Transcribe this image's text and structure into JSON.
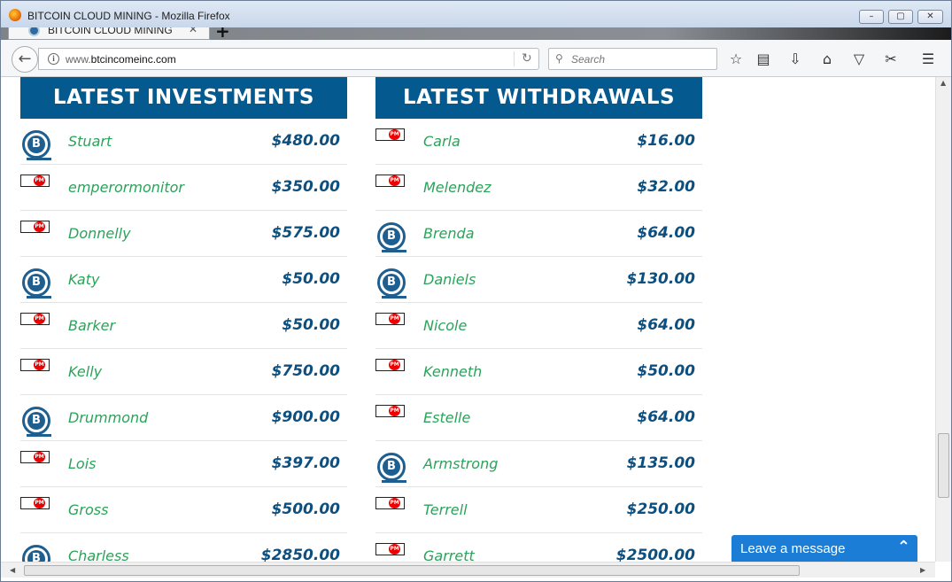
{
  "window": {
    "title": "BITCOIN CLOUD MINING - Mozilla Firefox"
  },
  "tab": {
    "title": "BITCOIN CLOUD MINING"
  },
  "navbar": {
    "url_prefix": "www.",
    "url_domain": "btcincomeinc.com",
    "search_placeholder": "Search"
  },
  "investments": {
    "title": "LATEST INVESTMENTS",
    "rows": [
      {
        "method": "btc",
        "name": "Stuart",
        "amount": "$480.00"
      },
      {
        "method": "pm",
        "name": "emperormonitor",
        "amount": "$350.00"
      },
      {
        "method": "pm",
        "name": "Donnelly",
        "amount": "$575.00"
      },
      {
        "method": "btc",
        "name": "Katy",
        "amount": "$50.00"
      },
      {
        "method": "pm",
        "name": "Barker",
        "amount": "$50.00"
      },
      {
        "method": "pm",
        "name": "Kelly",
        "amount": "$750.00"
      },
      {
        "method": "btc",
        "name": "Drummond",
        "amount": "$900.00"
      },
      {
        "method": "pm",
        "name": "Lois",
        "amount": "$397.00"
      },
      {
        "method": "pm",
        "name": "Gross",
        "amount": "$500.00"
      },
      {
        "method": "btc",
        "name": "Charless",
        "amount": "$2850.00"
      }
    ]
  },
  "withdrawals": {
    "title": "LATEST WITHDRAWALS",
    "rows": [
      {
        "method": "pm",
        "name": "Carla",
        "amount": "$16.00"
      },
      {
        "method": "pm",
        "name": "Melendez",
        "amount": "$32.00"
      },
      {
        "method": "btc",
        "name": "Brenda",
        "amount": "$64.00"
      },
      {
        "method": "btc",
        "name": "Daniels",
        "amount": "$130.00"
      },
      {
        "method": "pm",
        "name": "Nicole",
        "amount": "$64.00"
      },
      {
        "method": "pm",
        "name": "Kenneth",
        "amount": "$50.00"
      },
      {
        "method": "pm",
        "name": "Estelle",
        "amount": "$64.00"
      },
      {
        "method": "btc",
        "name": "Armstrong",
        "amount": "$135.00"
      },
      {
        "method": "pm",
        "name": "Terrell",
        "amount": "$250.00"
      },
      {
        "method": "pm",
        "name": "Garrett",
        "amount": "$2500.00"
      }
    ]
  },
  "icons": {
    "btc_glyph": "B",
    "pm_glyph": "PM"
  },
  "chat": {
    "label": "Leave a message"
  },
  "colors": {
    "header_blue": "#04598f",
    "name_green": "#2aa35a",
    "amount_blue": "#0d4f7f",
    "chat_blue": "#1c7dd6"
  }
}
